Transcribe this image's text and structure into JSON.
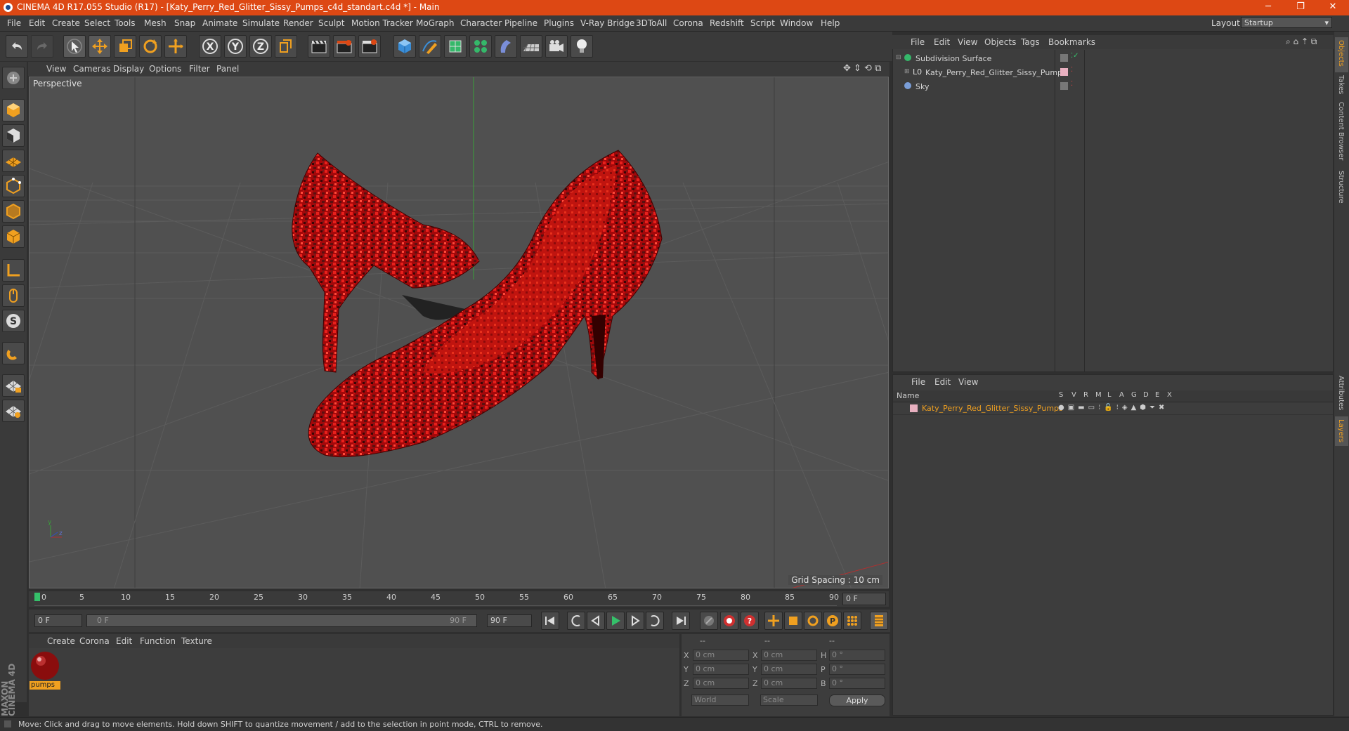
{
  "window": {
    "title": "CINEMA 4D R17.055 Studio (R17) - [Katy_Perry_Red_Glitter_Sissy_Pumps_c4d_standart.c4d *] - Main",
    "minimize": "─",
    "maximize": "❐",
    "close": "✕"
  },
  "menubar": {
    "items": [
      "File",
      "Edit",
      "Create",
      "Select",
      "Tools",
      "Mesh",
      "Snap",
      "Animate",
      "Simulate",
      "Render",
      "Sculpt",
      "Motion Tracker",
      "MoGraph",
      "Character",
      "Pipeline",
      "Plugins",
      "V-Ray Bridge",
      "3DToAll",
      "Corona",
      "Redshift",
      "Script",
      "Window",
      "Help"
    ],
    "layout_label": "Layout:",
    "layout_value": "Startup"
  },
  "viewport": {
    "menu": [
      "View",
      "Cameras",
      "Display",
      "Options",
      "Filter",
      "Panel"
    ],
    "label": "Perspective",
    "grid_spacing": "Grid Spacing : 10 cm"
  },
  "timeline": {
    "ticks": [
      "0",
      "5",
      "10",
      "15",
      "20",
      "25",
      "30",
      "35",
      "40",
      "45",
      "50",
      "55",
      "60",
      "65",
      "70",
      "75",
      "80",
      "85",
      "90"
    ],
    "current_frame": "0 F"
  },
  "transport": {
    "start_field": "0 F",
    "range_start": "0 F",
    "range_end": "90 F",
    "end_field": "90 F"
  },
  "material_manager": {
    "menu": [
      "Create",
      "Corona",
      "Edit",
      "Function",
      "Texture"
    ],
    "material_name": "pumps"
  },
  "coordinates": {
    "headers": [
      "--",
      "--",
      "--"
    ],
    "rows": [
      {
        "a": "X",
        "av": "0 cm",
        "b": "X",
        "bv": "0 cm",
        "c": "H",
        "cv": "0 °"
      },
      {
        "a": "Y",
        "av": "0 cm",
        "b": "Y",
        "bv": "0 cm",
        "c": "P",
        "cv": "0 °"
      },
      {
        "a": "Z",
        "av": "0 cm",
        "b": "Z",
        "bv": "0 cm",
        "c": "B",
        "cv": "0 °"
      }
    ],
    "space": "World",
    "mode": "Scale",
    "apply": "Apply"
  },
  "object_manager": {
    "menu": [
      "File",
      "Edit",
      "View",
      "Objects",
      "Tags",
      "Bookmarks"
    ],
    "objects": [
      "Subdivision Surface",
      "Katy_Perry_Red_Glitter_Sissy_Pumps",
      "Sky"
    ]
  },
  "layer_manager": {
    "menu": [
      "File",
      "Edit",
      "View"
    ],
    "col_name": "Name",
    "cols": [
      "S",
      "V",
      "R",
      "M",
      "L",
      "A",
      "G",
      "D",
      "E",
      "X"
    ],
    "layer_name": "Katy_Perry_Red_Glitter_Sissy_Pumps"
  },
  "right_tabs": [
    "Objects",
    "Takes",
    "Content Browser",
    "Structure",
    "Attributes",
    "Layers"
  ],
  "status": "Move: Click and drag to move elements. Hold down SHIFT to quantize movement / add to the selection in point mode, CTRL to remove.",
  "brand": "MAXON CINEMA 4D",
  "colors": {
    "accent": "#dd4814",
    "selected_text": "#f0a020"
  }
}
